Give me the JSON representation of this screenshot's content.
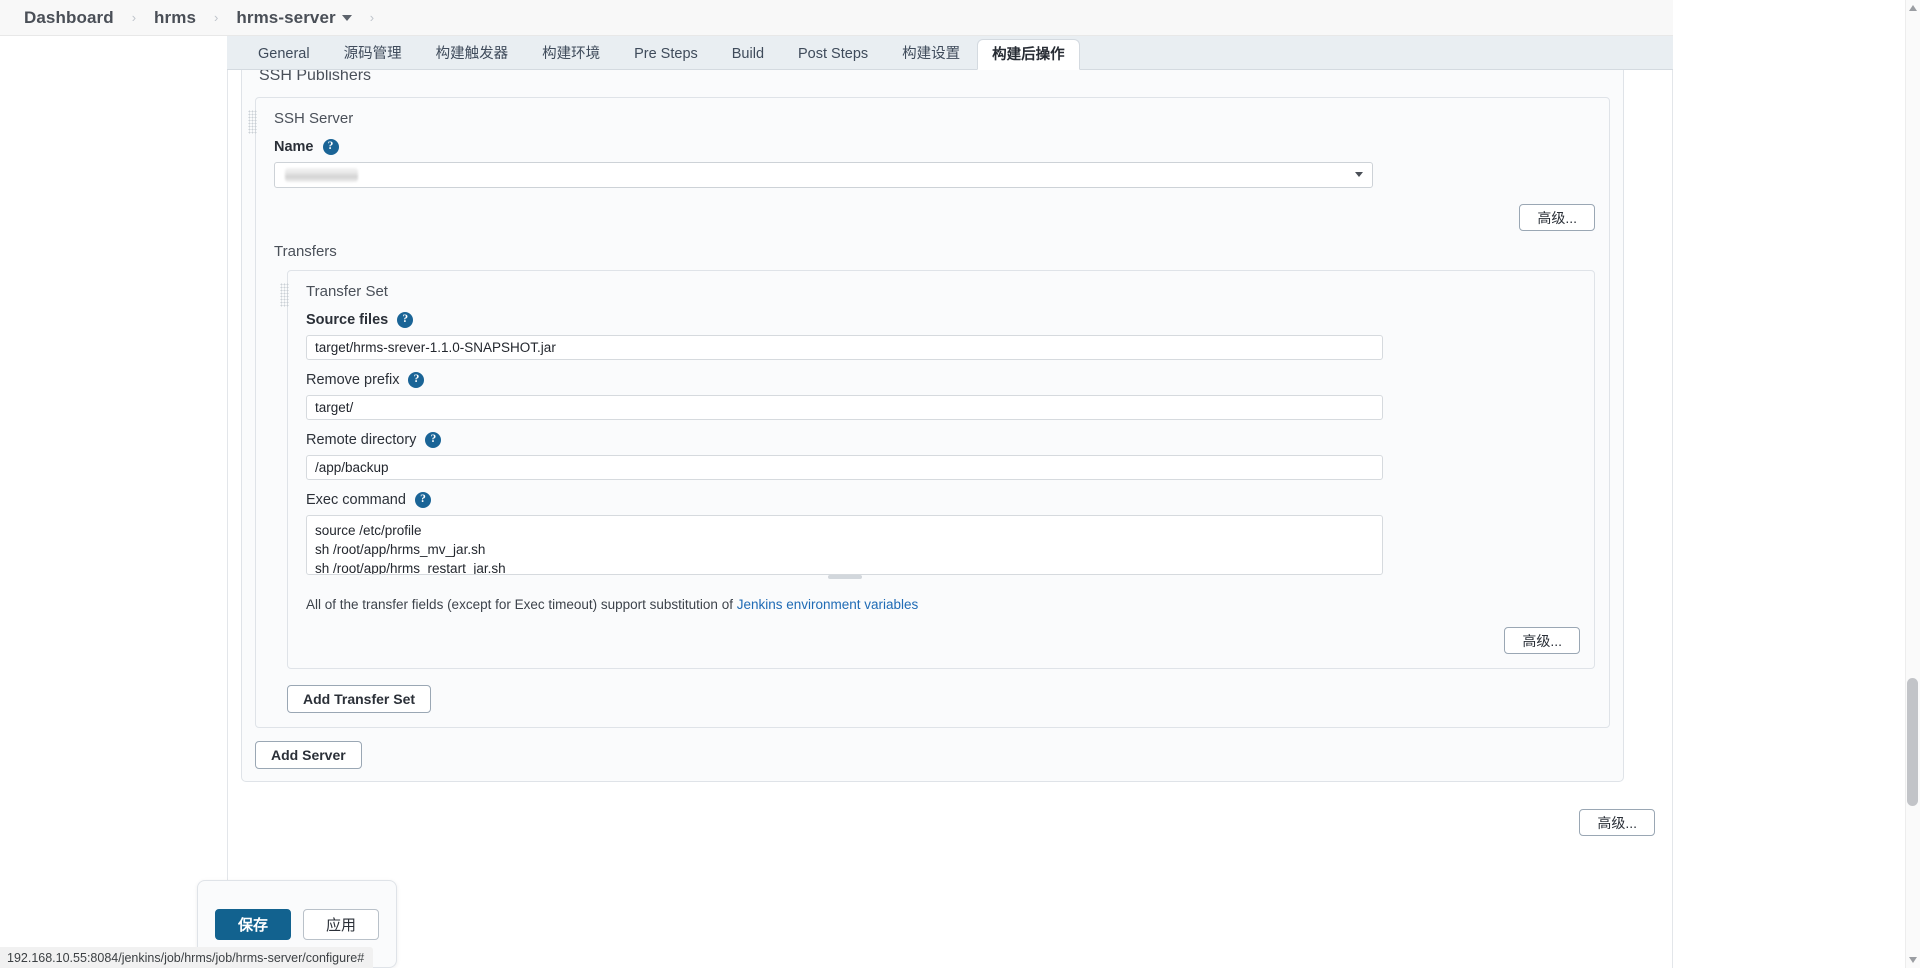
{
  "breadcrumb": {
    "items": [
      {
        "label": "Dashboard",
        "has_caret": false
      },
      {
        "label": "hrms",
        "has_caret": false
      },
      {
        "label": "hrms-server",
        "has_caret": true
      }
    ],
    "separator": "›"
  },
  "tabs": [
    {
      "label": "General",
      "active": false
    },
    {
      "label": "源码管理",
      "active": false
    },
    {
      "label": "构建触发器",
      "active": false
    },
    {
      "label": "构建环境",
      "active": false
    },
    {
      "label": "Pre Steps",
      "active": false
    },
    {
      "label": "Build",
      "active": false
    },
    {
      "label": "Post Steps",
      "active": false
    },
    {
      "label": "构建设置",
      "active": false
    },
    {
      "label": "构建后操作",
      "active": true
    }
  ],
  "panel": {
    "title": "SSH Publishers",
    "ssh_server": {
      "title": "SSH Server",
      "name_label": "Name",
      "name_value": "",
      "name_redacted": true,
      "advanced_button": "高级..."
    },
    "transfers": {
      "title": "Transfers",
      "transfer_set": {
        "title": "Transfer Set",
        "fields": [
          {
            "label": "Source files",
            "value": "target/hrms-srever-1.1.0-SNAPSHOT.jar",
            "type": "text"
          },
          {
            "label": "Remove prefix",
            "value": "target/",
            "type": "text"
          },
          {
            "label": "Remote directory",
            "value": "/app/backup",
            "type": "text"
          },
          {
            "label": "Exec command",
            "value": "source /etc/profile\nsh /root/app/hrms_mv_jar.sh\nsh /root/app/hrms_restart_jar.sh",
            "type": "textarea"
          }
        ],
        "hint_prefix": "All of the transfer fields (except for Exec timeout) support substitution of ",
        "hint_link": "Jenkins environment variables",
        "advanced_button": "高级..."
      },
      "add_transfer_set_button": "Add Transfer Set"
    },
    "add_server_button": "Add Server",
    "bottom_advanced_button": "高级..."
  },
  "submit_bar": {
    "save_label": "保存",
    "apply_label": "应用"
  },
  "status_bar": {
    "url": "192.168.10.55:8084/jenkins/job/hrms/job/hrms-server/configure#"
  },
  "icons": {
    "help": "?"
  },
  "colors": {
    "accent": "#12628f",
    "help_icon": "#1a6496",
    "link": "#1f6bb5",
    "tab_strip": "#e9eef2"
  }
}
